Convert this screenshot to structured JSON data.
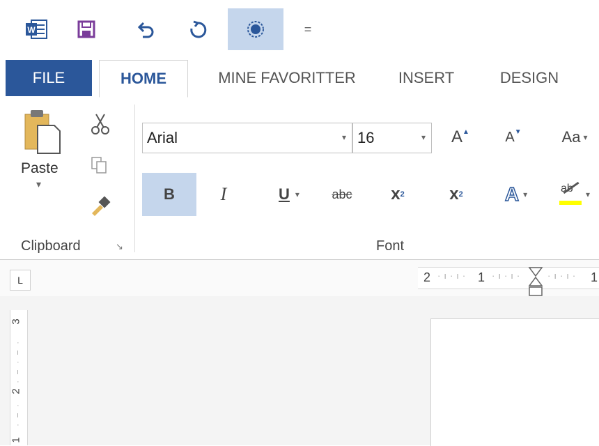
{
  "quick_access": {
    "items": [
      {
        "name": "word-logo"
      },
      {
        "name": "save"
      },
      {
        "name": "undo"
      },
      {
        "name": "redo"
      },
      {
        "name": "touch-mode"
      },
      {
        "name": "customize"
      }
    ],
    "customize_glyph": "="
  },
  "tabs": {
    "file": "FILE",
    "home": "HOME",
    "favorites": "MINE FAVORITTER",
    "insert": "INSERT",
    "design": "DESIGN"
  },
  "clipboard": {
    "paste_label": "Paste",
    "paste_arrow": "▾",
    "group_label": "Clipboard",
    "launcher_glyph": "↘"
  },
  "font": {
    "font_name": "Arial",
    "font_size": "16",
    "grow_label": "A",
    "shrink_label": "A",
    "change_case_label": "Aa",
    "bold_label": "B",
    "italic_label": "I",
    "underline_label": "U",
    "strike_label": "abc",
    "subscript_label": "x",
    "subscript_mark": "2",
    "superscript_label": "x",
    "superscript_mark": "2",
    "effects_label": "A",
    "highlight_label": "ab",
    "group_label": "Font",
    "dropdown_glyph": "▾"
  },
  "ruler": {
    "corner_glyph": "L",
    "h_labels": [
      "2",
      "1",
      "1"
    ],
    "v_labels": [
      "3",
      "2",
      "1"
    ]
  },
  "colors": {
    "accent": "#2b579a",
    "selected_bg": "#c5d6ec",
    "highlight_yellow": "#ffff00"
  }
}
